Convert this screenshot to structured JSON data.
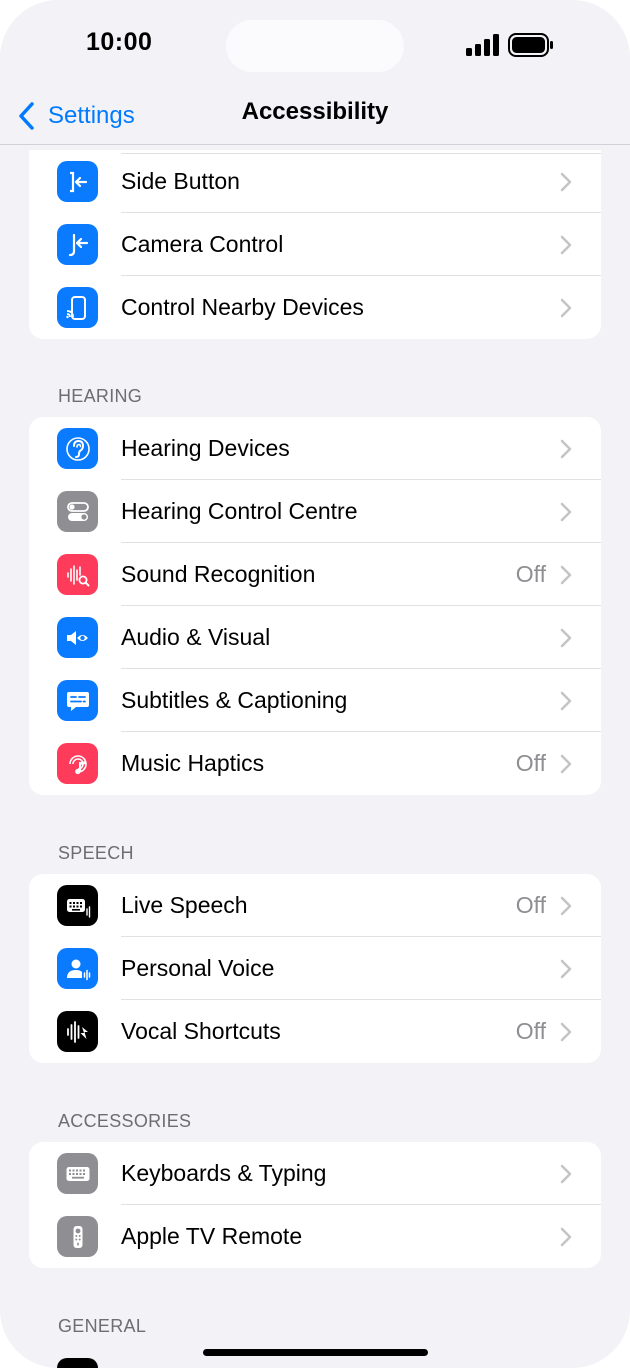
{
  "status_bar": {
    "time": "10:00"
  },
  "nav": {
    "back_label": "Settings",
    "title": "Accessibility"
  },
  "colors": {
    "accent": "#007aff",
    "blue": "#0a7aff",
    "gray": "#8e8e93",
    "pink": "#ff3b5c",
    "black": "#000000"
  },
  "groups": {
    "physical": {
      "rows": [
        {
          "label": "Side Button",
          "value": "",
          "icon": "side-button-icon",
          "color": "#0a7aff"
        },
        {
          "label": "Camera Control",
          "value": "",
          "icon": "camera-control-icon",
          "color": "#0a7aff"
        },
        {
          "label": "Control Nearby Devices",
          "value": "",
          "icon": "nearby-devices-icon",
          "color": "#0a7aff"
        }
      ]
    },
    "hearing": {
      "header": "HEARING",
      "rows": [
        {
          "label": "Hearing Devices",
          "value": "",
          "icon": "ear-icon",
          "color": "#0a7aff"
        },
        {
          "label": "Hearing Control Centre",
          "value": "",
          "icon": "toggles-icon",
          "color": "#8e8e93"
        },
        {
          "label": "Sound Recognition",
          "value": "Off",
          "icon": "sound-recognition-icon",
          "color": "#ff3b5c"
        },
        {
          "label": "Audio & Visual",
          "value": "",
          "icon": "audio-visual-icon",
          "color": "#0a7aff"
        },
        {
          "label": "Subtitles & Captioning",
          "value": "",
          "icon": "captions-icon",
          "color": "#0a7aff"
        },
        {
          "label": "Music Haptics",
          "value": "Off",
          "icon": "music-haptics-icon",
          "color": "#ff3b5c"
        }
      ]
    },
    "speech": {
      "header": "SPEECH",
      "rows": [
        {
          "label": "Live Speech",
          "value": "Off",
          "icon": "live-speech-icon",
          "color": "#000000"
        },
        {
          "label": "Personal Voice",
          "value": "",
          "icon": "personal-voice-icon",
          "color": "#0a7aff"
        },
        {
          "label": "Vocal Shortcuts",
          "value": "Off",
          "icon": "vocal-shortcuts-icon",
          "color": "#000000"
        }
      ]
    },
    "accessories": {
      "header": "ACCESSORIES",
      "rows": [
        {
          "label": "Keyboards & Typing",
          "value": "",
          "icon": "keyboard-icon",
          "color": "#8e8e93"
        },
        {
          "label": "Apple TV Remote",
          "value": "",
          "icon": "tv-remote-icon",
          "color": "#8e8e93"
        }
      ]
    },
    "general": {
      "header": "GENERAL"
    }
  }
}
